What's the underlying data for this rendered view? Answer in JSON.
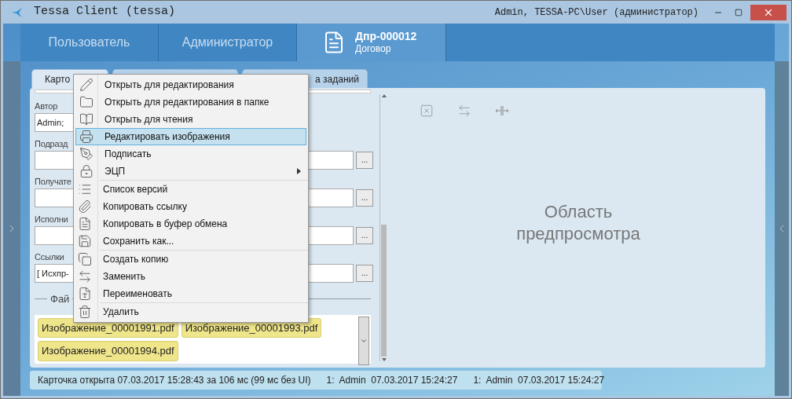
{
  "window": {
    "title": "Tessa Client (tessa)",
    "user": "Admin, TESSA-PC\\User (администратор)"
  },
  "header_tabs": [
    {
      "kind": "text",
      "label": "Пользователь",
      "selected": false
    },
    {
      "kind": "text",
      "label": "Администратор",
      "selected": false
    },
    {
      "kind": "document",
      "label": "Дпр-000012",
      "subtitle": "Договор",
      "selected": true
    }
  ],
  "card_tabs": [
    {
      "label": "Карто",
      "selected": true
    },
    {
      "selected": false
    },
    {
      "label": "а заданий",
      "selected": false
    }
  ],
  "fields": [
    {
      "label": "Автор",
      "value": "Admin;",
      "lookup": false
    },
    {
      "label": "Подразд",
      "lookup": true
    },
    {
      "label": "Получате",
      "lookup": true
    },
    {
      "label": "Исполни",
      "lookup": true
    },
    {
      "label": "Ссылки",
      "value": "[ Исхпр-",
      "lookup": true
    }
  ],
  "lookup_button": "...",
  "files": {
    "label": "Фай",
    "items": [
      "Изображение_00001991.pdf",
      "Изображение_00001993.pdf",
      "Изображение_00001994.pdf"
    ]
  },
  "context_menu": {
    "groups": [
      [
        {
          "label": "Открыть для редактирования",
          "selected": false,
          "submenu": false
        },
        {
          "label": "Открыть для редактирования в папке",
          "selected": false,
          "submenu": false
        },
        {
          "label": "Открыть для чтения",
          "selected": false,
          "submenu": false
        },
        {
          "label": "Редактировать изображения",
          "selected": true,
          "submenu": false
        },
        {
          "label": "Подписать",
          "selected": false,
          "submenu": false
        },
        {
          "label": "ЭЦП",
          "selected": false,
          "submenu": true
        }
      ],
      [
        {
          "label": "Список версий",
          "selected": false,
          "submenu": false
        },
        {
          "label": "Копировать ссылку",
          "selected": false,
          "submenu": false
        },
        {
          "label": "Копировать в буфер обмена",
          "selected": false,
          "submenu": false
        },
        {
          "label": "Сохранить как...",
          "selected": false,
          "submenu": false
        }
      ],
      [
        {
          "label": "Создать копию",
          "selected": false,
          "submenu": false
        },
        {
          "label": "Заменить",
          "selected": false,
          "submenu": false
        },
        {
          "label": "Переименовать",
          "selected": false,
          "submenu": false
        }
      ],
      [
        {
          "label": "Удалить",
          "selected": false,
          "submenu": false
        }
      ]
    ]
  },
  "preview": {
    "placeholder": "Область предпросмотра"
  },
  "status_bar": [
    "Карточка открыта 07.03.2017 15:28:43 за 106 мс (99 мс без UI)",
    "1:  Admin  07.03.2017 15:24:27",
    "1:  Admin  07.03.2017 15:24:27"
  ]
}
